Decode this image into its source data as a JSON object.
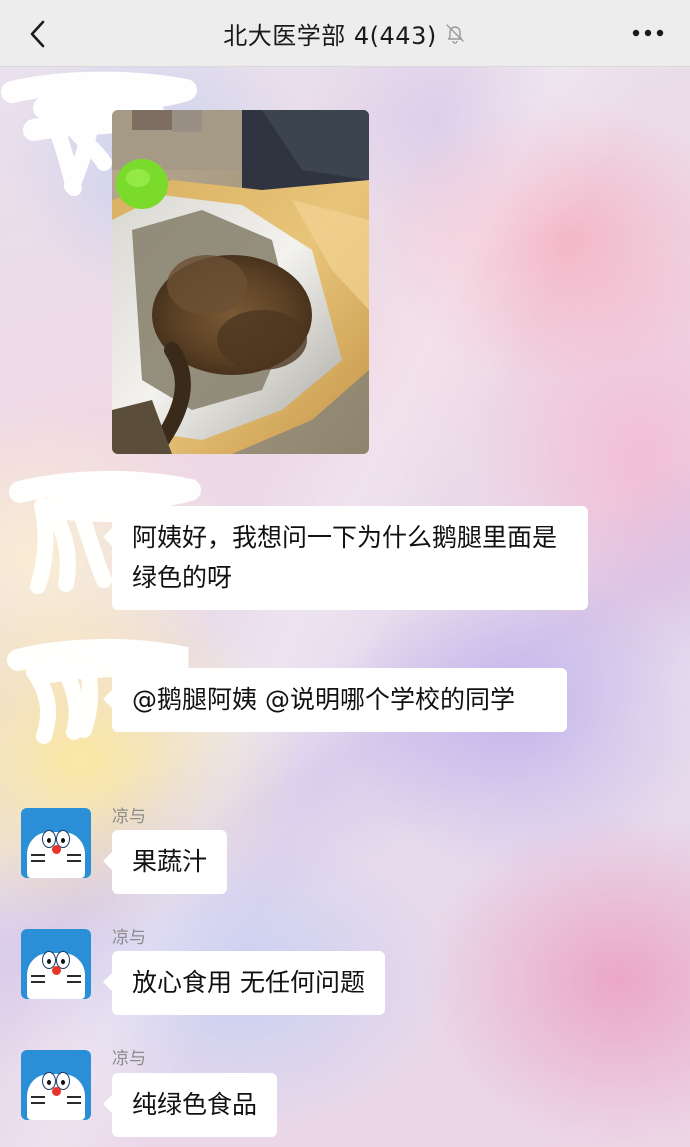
{
  "header": {
    "title": "北大医学部 4(443)",
    "back_icon": "chevron-left-icon",
    "mute_icon": "bell-muted-icon",
    "more_icon": "more-dots-icon"
  },
  "messages": [
    {
      "type": "image",
      "avatar": "scribbled-out"
    },
    {
      "type": "text",
      "avatar": "scribbled-out",
      "text": "阿姨好，我想问一下为什么鹅腿里面是绿色的呀"
    },
    {
      "type": "text",
      "avatar": "scribbled-out",
      "text": "@鹅腿阿姨 @说明哪个学校的同学"
    },
    {
      "type": "text",
      "avatar": "doraemon",
      "sender": "凉与",
      "text": "果蔬汁"
    },
    {
      "type": "text",
      "avatar": "doraemon",
      "sender": "凉与",
      "text": "放心食用 无任何问题"
    },
    {
      "type": "text",
      "avatar": "doraemon",
      "sender": "凉与",
      "text": "纯绿色食品"
    }
  ],
  "colors": {
    "navbar_bg": "#ededed",
    "bubble_bg": "#ffffff",
    "sender_name": "#8b8b8b",
    "avatar_blue": "#2b8fd8"
  }
}
